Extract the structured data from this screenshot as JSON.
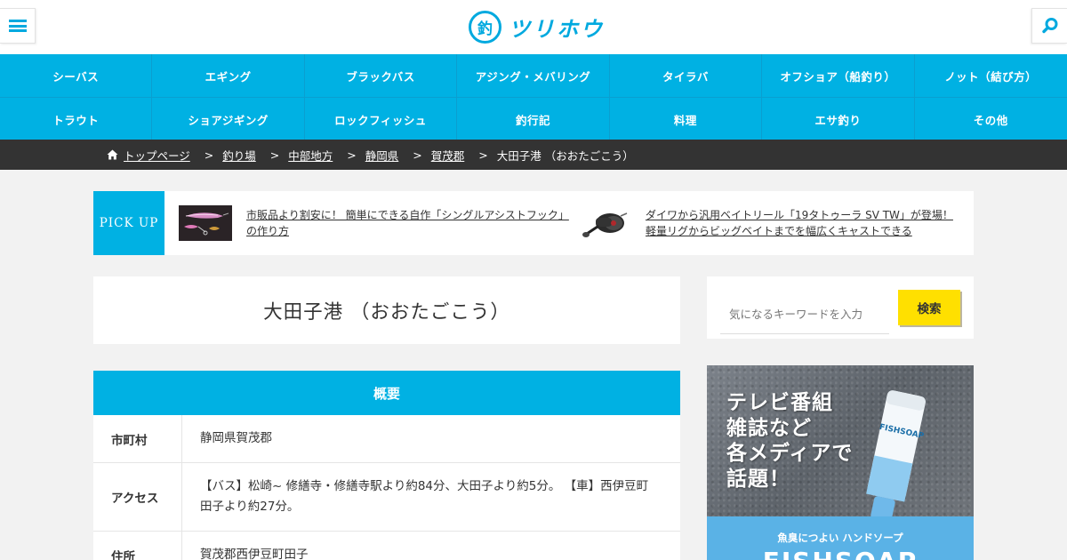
{
  "header": {
    "logo_mark": "釣",
    "logo_text": "ツリホウ"
  },
  "nav": {
    "row1": [
      "シーバス",
      "エギング",
      "ブラックバス",
      "アジング・メバリング",
      "タイラバ",
      "オフショア（船釣り）",
      "ノット（結び方）"
    ],
    "row2": [
      "トラウト",
      "ショアジギング",
      "ロックフィッシュ",
      "釣行記",
      "料理",
      "エサ釣り",
      "その他"
    ]
  },
  "breadcrumb": {
    "items": [
      "トップページ",
      "釣り場",
      "中部地方",
      "静岡県",
      "賀茂郡"
    ],
    "current": "大田子港 （おおたごこう）",
    "separator": ">"
  },
  "pickup": {
    "label": "PICK UP",
    "items": [
      {
        "text": "市販品より割安に！ 簡単にできる自作「シングルアシストフック」の作り方"
      },
      {
        "text": "ダイワから汎用ベイトリール「19タトゥーラ SV TW」が登場！軽量リグからビッグベイトまでを幅広くキャストできる"
      }
    ]
  },
  "title": "大田子港 （おおたごこう）",
  "overview": {
    "heading": "概要",
    "rows": [
      {
        "key": "市町村",
        "value": "静岡県賀茂郡"
      },
      {
        "key": "アクセス",
        "value": "【バス】松崎~ 修繕寺・修繕寺駅より約84分、大田子より約5分。 【車】西伊豆町 田子より約27分。"
      },
      {
        "key": "住所",
        "value": "賀茂郡西伊豆町田子"
      }
    ]
  },
  "search": {
    "placeholder": "気になるキーワードを入力",
    "button": "検索"
  },
  "ad": {
    "headline": [
      "テレビ番組",
      "雑誌など",
      "各メディアで",
      "話題！"
    ],
    "subline": "魚臭につよい ハンドソープ",
    "brand": "FISHSOAP",
    "tube_label": "FISHSOAP"
  },
  "colors": {
    "accent": "#00b1e3",
    "breadcrumb_bg": "#333333",
    "search_button": "#ffe000",
    "page_bg": "#f2f2f2"
  }
}
